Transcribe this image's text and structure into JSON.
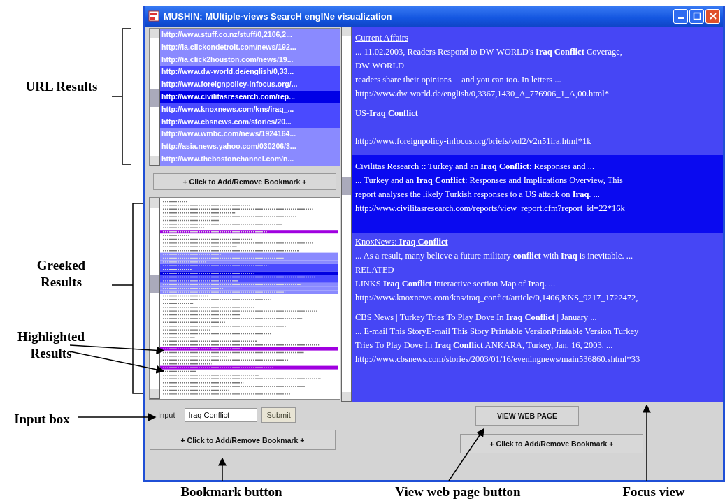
{
  "annotations": [
    {
      "text": "URL Results"
    },
    {
      "text": "Greeked Results"
    },
    {
      "text": "Highlighted Results"
    },
    {
      "text": "Input box"
    },
    {
      "text": "Bookmark button"
    },
    {
      "text": "View web page button"
    },
    {
      "text": "Focus view"
    }
  ],
  "window": {
    "title": "MUSHIN: MUltiple-views SearcH engINe visualization"
  },
  "url_results": [
    {
      "text": "http://www.stuff.co.nz/stuff/0,2106,2...",
      "color": "#8a8aff"
    },
    {
      "text": "http://ia.clickondetroit.com/news/192...",
      "color": "#8a8aff"
    },
    {
      "text": "http://ia.click2houston.com/news/19...",
      "color": "#8a8aff"
    },
    {
      "text": "http://www.dw-world.de/english/0,33...",
      "color": "#4a4aff"
    },
    {
      "text": "http://www.foreignpolicy-infocus.org/...",
      "color": "#4a4aff"
    },
    {
      "text": "http://www.civilitasresearch.com/rep...",
      "color": "#0000e6"
    },
    {
      "text": "http://www.knoxnews.com/kns/iraq_...",
      "color": "#4a4aff"
    },
    {
      "text": "http://www.cbsnews.com/stories/20...",
      "color": "#4a4aff"
    },
    {
      "text": "http://www.wmbc.com/news/1924164...",
      "color": "#8a8aff"
    },
    {
      "text": "http://asia.news.yahoo.com/030206/3...",
      "color": "#8a8aff"
    },
    {
      "text": "http://www.thebostonchannel.com/n...",
      "color": "#8a8aff"
    }
  ],
  "left_bookmark_button": "+ Click to Add/Remove Bookmark +",
  "input": {
    "label": "Input",
    "value": "Iraq Conflict",
    "submit": "Submit"
  },
  "focus_view": {
    "results": [
      {
        "title": "Current Affairs",
        "lines": [
          "... 11.02.2003, Readers Respond to DW-WORLD's **Iraq Conflict** Coverage,",
          "DW-WORLD",
          "readers share their opinions -- and you can too. In letters ..."
        ],
        "url": "http://www.dw-world.de/english/0,3367,1430_A_776906_1_A,00.html*",
        "color": "#4646f5"
      },
      {
        "title": "US-**Iraq Conflict**",
        "url": "http://www.foreignpolicy-infocus.org/briefs/vol2/v2n51ira.html*1k",
        "color": "#4646f5"
      },
      {
        "title": "Civilitas Research :: Turkey and an **Iraq Conflict**: Responses and ...",
        "lines": [
          "... Turkey and an **Iraq Conflict**: Responses and Implications Overview, This",
          "report analyses the likely Turkish responses to a US attack on **Iraq**. ..."
        ],
        "url": "http://www.civilitasresearch.com/reports/view_report.cfm?report_id=22*16k",
        "color": "#0a0af0"
      },
      {
        "title": "KnoxNews: **Iraq Conflict**",
        "lines": [
          "... As a result, many believe a future military **conflict** with **Iraq** is inevitable. ...",
          "RELATED",
          "LINKS **Iraq Conflict** interactive section Map of **Iraq**. ..."
        ],
        "url": "http://www.knoxnews.com/kns/iraq_confict/article/0,1406,KNS_9217_1722472,",
        "color": "#4646f5"
      },
      {
        "title": "CBS News | Turkey Tries To Play Dove In **Iraq Conflict** | January ...",
        "lines": [
          "... E-mail This StoryE-mail This Story Printable VersionPrintable Version Turkey",
          "Tries To Play Dove In **Iraq Conflict** ANKARA, Turkey, Jan. 16, 2003. ..."
        ],
        "url": "http://www.cbsnews.com/stories/2003/01/16/eveningnews/main536860.shtml*33",
        "color": "#4646f5"
      }
    ]
  },
  "bottom_bookmark_button": "+ Click to Add/Remove Bookmark +",
  "view_button": "VIEW WEB PAGE",
  "right_bookmark_button": "+ Click to Add/Remove Bookmark +"
}
